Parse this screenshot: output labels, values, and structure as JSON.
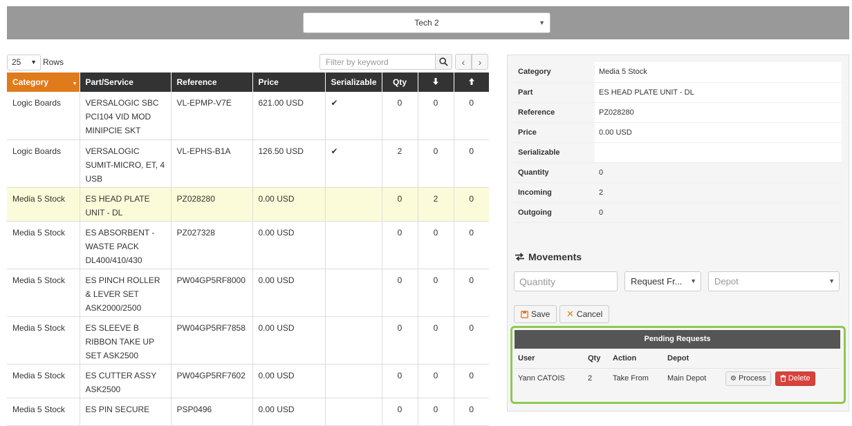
{
  "header": {
    "tech_select": "Tech 2"
  },
  "table_controls": {
    "rows_value": "25",
    "rows_label": "Rows",
    "filter_placeholder": "Filter by keyword"
  },
  "table": {
    "headers": [
      "Category",
      "Part/Service",
      "Reference",
      "Price",
      "Serializable",
      "Qty"
    ],
    "rows": [
      {
        "category": "Logic Boards",
        "part": "VERSALOGIC SBC PCI104 VID MOD MINIPCIE SKT",
        "reference": "VL-EPMP-V7E",
        "price": "621.00 USD",
        "serializable": "✔",
        "qty": "0",
        "incoming": "0",
        "outgoing": "0"
      },
      {
        "category": "Logic Boards",
        "part": "VERSALOGIC SUMIT-MICRO, ET, 4 USB",
        "reference": "VL-EPHS-B1A",
        "price": "126.50 USD",
        "serializable": "✔",
        "qty": "2",
        "incoming": "0",
        "outgoing": "0"
      },
      {
        "category": "Media 5 Stock",
        "part": "ES HEAD PLATE UNIT - DL",
        "reference": "PZ028280",
        "price": "0.00 USD",
        "serializable": "",
        "qty": "0",
        "incoming": "2",
        "outgoing": "0"
      },
      {
        "category": "Media 5 Stock",
        "part": "ES ABSORBENT - WASTE PACK DL400/410/430",
        "reference": "PZ027328",
        "price": "0.00 USD",
        "serializable": "",
        "qty": "0",
        "incoming": "0",
        "outgoing": "0"
      },
      {
        "category": "Media 5 Stock",
        "part": "ES PINCH ROLLER & LEVER SET ASK2000/2500",
        "reference": "PW04GP5RF8000",
        "price": "0.00 USD",
        "serializable": "",
        "qty": "0",
        "incoming": "0",
        "outgoing": "0"
      },
      {
        "category": "Media 5 Stock",
        "part": "ES SLEEVE B RIBBON TAKE UP SET ASK2500",
        "reference": "PW04GP5RF7858",
        "price": "0.00 USD",
        "serializable": "",
        "qty": "0",
        "incoming": "0",
        "outgoing": "0"
      },
      {
        "category": "Media 5 Stock",
        "part": "ES CUTTER ASSY ASK2500",
        "reference": "PW04GP5RF7602",
        "price": "0.00 USD",
        "serializable": "",
        "qty": "0",
        "incoming": "0",
        "outgoing": "0"
      },
      {
        "category": "Media 5 Stock",
        "part": "ES PIN SECURE",
        "reference": "PSP0496",
        "price": "0.00 USD",
        "serializable": "",
        "qty": "0",
        "incoming": "0",
        "outgoing": "0"
      }
    ]
  },
  "detail": {
    "rows": [
      {
        "label": "Category",
        "value": "Media 5 Stock"
      },
      {
        "label": "Part",
        "value": "ES HEAD PLATE UNIT - DL"
      },
      {
        "label": "Reference",
        "value": "PZ028280"
      },
      {
        "label": "Price",
        "value": "0.00 USD"
      },
      {
        "label": "Serializable",
        "value": ""
      },
      {
        "label": "Quantity",
        "value": "0"
      },
      {
        "label": "Incoming",
        "value": "2"
      },
      {
        "label": "Outgoing",
        "value": "0"
      }
    ]
  },
  "movements": {
    "title": "Movements",
    "quantity_placeholder": "Quantity",
    "action_value": "Request Fr...",
    "depot_value": "Depot",
    "save_label": "Save",
    "cancel_label": "Cancel"
  },
  "pending": {
    "title": "Pending Requests",
    "headers": [
      "User",
      "Qty",
      "Action",
      "Depot"
    ],
    "rows": [
      {
        "user": "Yann CATOIS",
        "qty": "2",
        "action": "Take From",
        "depot": "Main Depot"
      }
    ],
    "process_label": "Process",
    "delete_label": "Delete"
  },
  "colors": {
    "sorted_header": "#e07b1c",
    "selected_row": "#fbfbd9",
    "highlight_frame": "#8cc94e",
    "delete_button": "#d9413b"
  }
}
